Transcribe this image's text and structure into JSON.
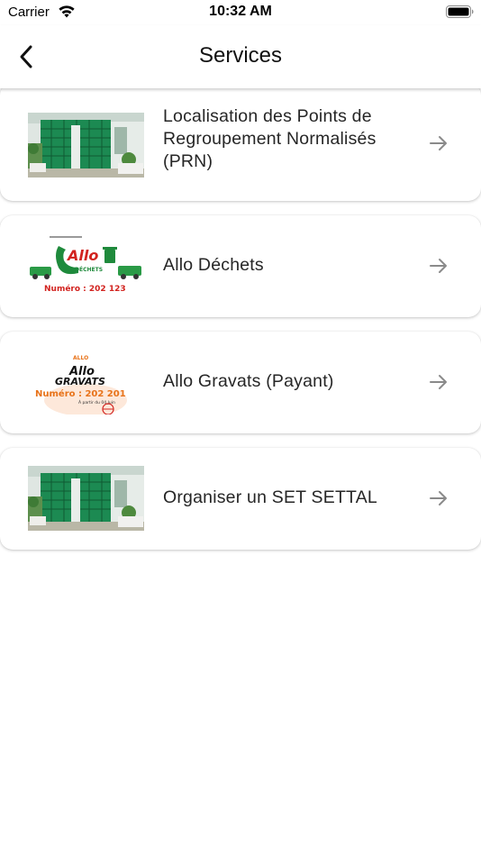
{
  "status_bar": {
    "carrier": "Carrier",
    "time": "10:32 AM"
  },
  "nav": {
    "title": "Services",
    "back_icon": "chevron-left-icon"
  },
  "services": [
    {
      "label": "Localisation des Points de Regroupement Normalisés (PRN)",
      "image": "prn-site-photo"
    },
    {
      "label": "Allo Déchets",
      "image": "allo-dechets-logo",
      "logo_text": {
        "brand": "Allo",
        "sub": "DÉCHETS",
        "number": "Numéro : 202 123"
      }
    },
    {
      "label": "Allo Gravats (Payant)",
      "image": "allo-gravats-logo",
      "logo_text": {
        "brand": "Allo",
        "sub": "GRAVATS",
        "number": "Numéro : 202 201",
        "note": "À partir du 04 Juin"
      }
    },
    {
      "label": "Organiser un SET SETTAL",
      "image": "prn-site-photo"
    }
  ],
  "colors": {
    "accent_green": "#1f8a3c",
    "logo_red": "#d2231f",
    "logo_orange": "#e8731a",
    "arrow_gray": "#8a8a8a"
  }
}
